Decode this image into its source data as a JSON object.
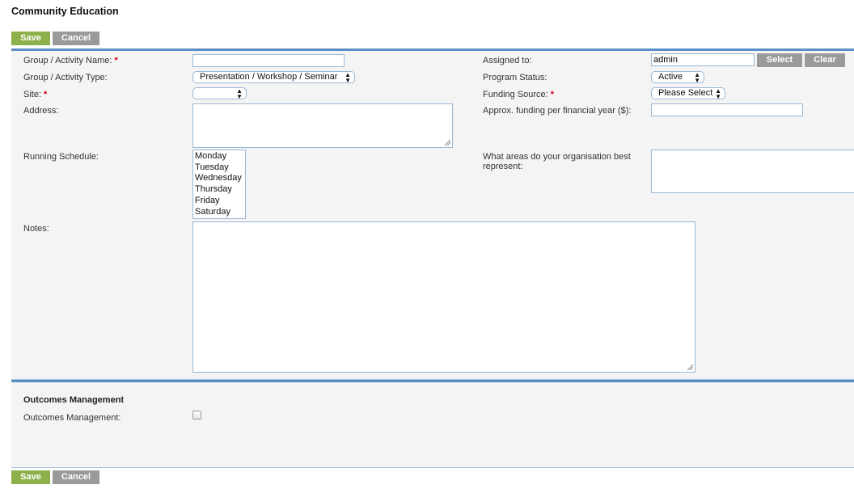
{
  "page": {
    "title": "Community Education"
  },
  "toolbar": {
    "save_label": "Save",
    "cancel_label": "Cancel"
  },
  "form": {
    "group_name": {
      "label": "Group / Activity Name:",
      "required": "*",
      "value": ""
    },
    "group_type": {
      "label": "Group / Activity Type:",
      "value": "Presentation / Workshop / Seminar"
    },
    "site": {
      "label": "Site:",
      "required": "*",
      "value": ""
    },
    "address": {
      "label": "Address:",
      "value": ""
    },
    "running_schedule": {
      "label": "Running Schedule:",
      "options": [
        "Monday",
        "Tuesday",
        "Wednesday",
        "Thursday",
        "Friday",
        "Saturday"
      ]
    },
    "notes": {
      "label": "Notes:",
      "value": ""
    },
    "assigned_to": {
      "label": "Assigned to:",
      "value": "admin",
      "select_label": "Select",
      "clear_label": "Clear"
    },
    "program_status": {
      "label": "Program Status:",
      "value": "Active"
    },
    "funding_source": {
      "label": "Funding Source:",
      "required": "*",
      "value": "Please Select"
    },
    "approx_funding": {
      "label": "Approx. funding per financial year ($):",
      "value": ""
    },
    "areas_represent": {
      "label": "What areas do your organisation best represent:",
      "value": ""
    }
  },
  "outcomes": {
    "heading": "Outcomes Management",
    "checkbox_label": "Outcomes Management:",
    "checked": false
  },
  "icons": {
    "select_arrows": "▲▼"
  }
}
